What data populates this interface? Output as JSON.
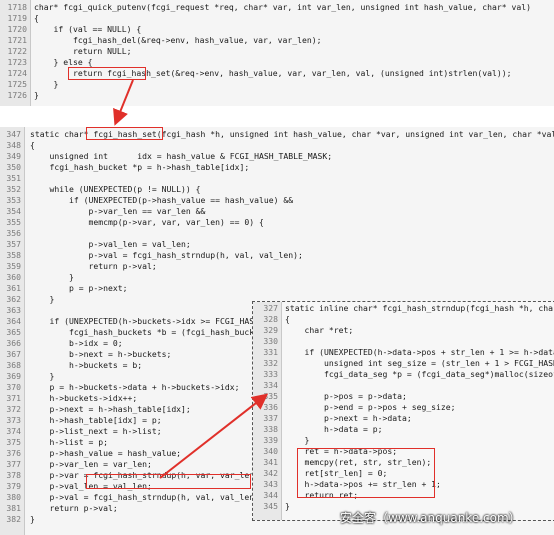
{
  "top_panel": {
    "lines": [
      {
        "n": "1718",
        "t": "char* fcgi_quick_putenv(fcgi_request *req, char* var, int var_len, unsigned int hash_value, char* val)"
      },
      {
        "n": "1719",
        "t": "{"
      },
      {
        "n": "1720",
        "t": "    if (val == NULL) {"
      },
      {
        "n": "1721",
        "t": "        fcgi_hash_del(&req->env, hash_value, var, var_len);"
      },
      {
        "n": "1722",
        "t": "        return NULL;"
      },
      {
        "n": "1723",
        "t": "    } else {"
      },
      {
        "n": "1724",
        "t": "        return fcgi_hash_set(&req->env, hash_value, var, var_len, val, (unsigned int)strlen(val));"
      },
      {
        "n": "1725",
        "t": "    }"
      },
      {
        "n": "1726",
        "t": "}"
      }
    ]
  },
  "main_panel": {
    "lines": [
      {
        "n": "347",
        "t": "static char* fcgi_hash_set(fcgi_hash *h, unsigned int hash_value, char *var, unsigned int var_len, char *val, unsign"
      },
      {
        "n": "348",
        "t": "{"
      },
      {
        "n": "349",
        "t": "    unsigned int      idx = hash_value & FCGI_HASH_TABLE_MASK;"
      },
      {
        "n": "350",
        "t": "    fcgi_hash_bucket *p = h->hash_table[idx];"
      },
      {
        "n": "351",
        "t": ""
      },
      {
        "n": "352",
        "t": "    while (UNEXPECTED(p != NULL)) {"
      },
      {
        "n": "353",
        "t": "        if (UNEXPECTED(p->hash_value == hash_value) &&"
      },
      {
        "n": "354",
        "t": "            p->var_len == var_len &&"
      },
      {
        "n": "355",
        "t": "            memcmp(p->var, var, var_len) == 0) {"
      },
      {
        "n": "356",
        "t": ""
      },
      {
        "n": "357",
        "t": "            p->val_len = val_len;"
      },
      {
        "n": "358",
        "t": "            p->val = fcgi_hash_strndup(h, val, val_len);"
      },
      {
        "n": "359",
        "t": "            return p->val;"
      },
      {
        "n": "360",
        "t": "        }"
      },
      {
        "n": "361",
        "t": "        p = p->next;"
      },
      {
        "n": "362",
        "t": "    }"
      },
      {
        "n": "363",
        "t": ""
      },
      {
        "n": "364",
        "t": "    if (UNEXPECTED(h->buckets->idx >= FCGI_HASH_T"
      },
      {
        "n": "365",
        "t": "        fcgi_hash_buckets *b = (fcgi_hash_buckets"
      },
      {
        "n": "366",
        "t": "        b->idx = 0;"
      },
      {
        "n": "367",
        "t": "        b->next = h->buckets;"
      },
      {
        "n": "368",
        "t": "        h->buckets = b;"
      },
      {
        "n": "369",
        "t": "    }"
      },
      {
        "n": "370",
        "t": "    p = h->buckets->data + h->buckets->idx;"
      },
      {
        "n": "371",
        "t": "    h->buckets->idx++;"
      },
      {
        "n": "372",
        "t": "    p->next = h->hash_table[idx];"
      },
      {
        "n": "373",
        "t": "    h->hash_table[idx] = p;"
      },
      {
        "n": "374",
        "t": "    p->list_next = h->list;"
      },
      {
        "n": "375",
        "t": "    h->list = p;"
      },
      {
        "n": "376",
        "t": "    p->hash_value = hash_value;"
      },
      {
        "n": "377",
        "t": "    p->var_len = var_len;"
      },
      {
        "n": "378",
        "t": "    p->var = fcgi_hash_strndup(h, var, var_len);"
      },
      {
        "n": "379",
        "t": "    p->val_len = val_len;"
      },
      {
        "n": "380",
        "t": "    p->val = fcgi_hash_strndup(h, val, val_len);"
      },
      {
        "n": "381",
        "t": "    return p->val;"
      },
      {
        "n": "382",
        "t": "}"
      }
    ]
  },
  "popup_panel": {
    "lines": [
      {
        "n": "327",
        "t": "static inline char* fcgi_hash_strndup(fcgi_hash *h, char *st"
      },
      {
        "n": "328",
        "t": "{"
      },
      {
        "n": "329",
        "t": "    char *ret;"
      },
      {
        "n": "330",
        "t": ""
      },
      {
        "n": "331",
        "t": "    if (UNEXPECTED(h->data->pos + str_len + 1 >= h->data->er"
      },
      {
        "n": "332",
        "t": "        unsigned int seg_size = (str_len + 1 > FCGI_HASH_SEG"
      },
      {
        "n": "333",
        "t": "        fcgi_data_seg *p = (fcgi_data_seg*)malloc(sizeof(fcg"
      },
      {
        "n": "334",
        "t": ""
      },
      {
        "n": "335",
        "t": "        p->pos = p->data;"
      },
      {
        "n": "336",
        "t": "        p->end = p->pos + seg_size;"
      },
      {
        "n": "337",
        "t": "        p->next = h->data;"
      },
      {
        "n": "338",
        "t": "        h->data = p;"
      },
      {
        "n": "339",
        "t": "    }"
      },
      {
        "n": "340",
        "t": "    ret = h->data->pos;"
      },
      {
        "n": "341",
        "t": "    memcpy(ret, str, str_len);"
      },
      {
        "n": "342",
        "t": "    ret[str_len] = 0;"
      },
      {
        "n": "343",
        "t": "    h->data->pos += str_len + 1;"
      },
      {
        "n": "344",
        "t": "    return ret;"
      },
      {
        "n": "345",
        "t": "}"
      }
    ]
  },
  "watermark": "安全客（www.anquanke.com）",
  "colors": {
    "highlight_box": "#e0302a",
    "arrow": "#e0302a"
  }
}
